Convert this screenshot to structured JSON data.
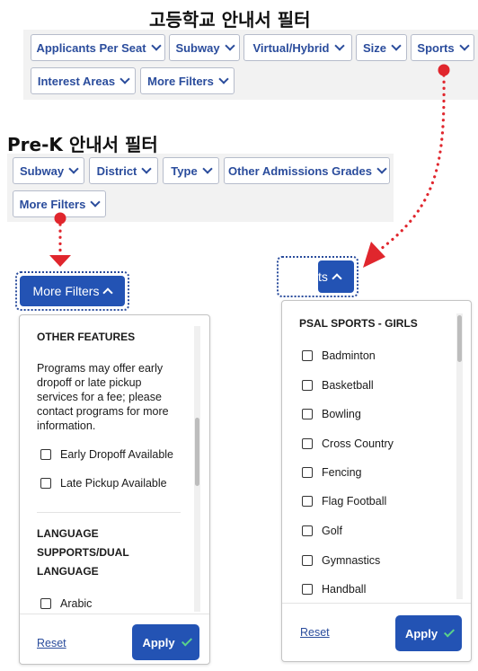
{
  "high_school": {
    "heading": "고등학교 안내서 필터",
    "filters": [
      "Applicants Per Seat",
      "Subway",
      "Virtual/Hybrid",
      "Size",
      "Sports",
      "Interest Areas",
      "More Filters"
    ]
  },
  "prek": {
    "heading": "Pre-K 안내서 필터",
    "filters": [
      "Subway",
      "District",
      "Type",
      "Other Admissions Grades",
      "More Filters"
    ]
  },
  "more_filters_panel": {
    "button_label": "More Filters",
    "section1_title": "OTHER FEATURES",
    "section1_desc": "Programs may offer early dropoff or late pickup services for a fee; please contact programs for more information.",
    "options": [
      "Early Dropoff Available",
      "Late Pickup Available"
    ],
    "section2_title": "LANGUAGE SUPPORTS/DUAL LANGUAGE",
    "section2_options": [
      "Arabic"
    ],
    "reset_label": "Reset",
    "apply_label": "Apply"
  },
  "sports_panel": {
    "button_label": "ts",
    "section_title": "PSAL SPORTS - GIRLS",
    "options": [
      "Badminton",
      "Basketball",
      "Bowling",
      "Cross Country",
      "Fencing",
      "Flag Football",
      "Golf",
      "Gymnastics",
      "Handball"
    ],
    "reset_label": "Reset",
    "apply_label": "Apply"
  },
  "colors": {
    "accent": "#2353b4",
    "chip_text": "#2a4c9c",
    "annotation_red": "#e0262d",
    "check_green": "#5ad28a"
  }
}
